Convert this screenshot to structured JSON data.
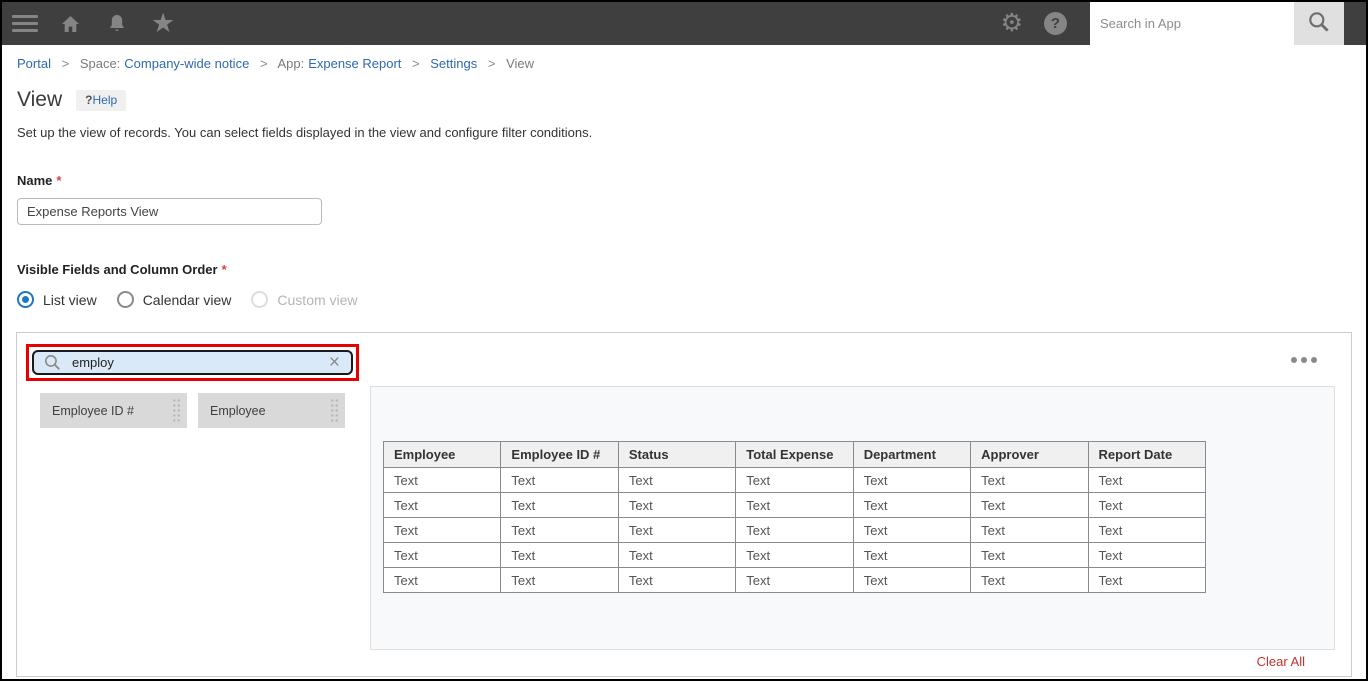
{
  "topbar": {
    "icons": [
      "hamburger-icon",
      "home-icon",
      "bell-icon",
      "star-icon",
      "gear-icon",
      "help-circle-icon",
      "magnifier-icon"
    ],
    "star_glyph": "★",
    "gear_glyph": "⚙",
    "help_glyph": "?",
    "search": {
      "placeholder": "Search in App",
      "value": ""
    }
  },
  "breadcrumb": {
    "separator": ">",
    "items": [
      {
        "prefix": "",
        "label": "Portal",
        "link": true
      },
      {
        "prefix": "Space:",
        "label": "Company-wide notice",
        "link": true
      },
      {
        "prefix": "App:",
        "label": "Expense Report",
        "link": true
      },
      {
        "prefix": "",
        "label": "Settings",
        "link": true
      },
      {
        "prefix": "",
        "label": "View",
        "link": false
      }
    ]
  },
  "header": {
    "title": "View",
    "help_q": "?",
    "help_text": "Help"
  },
  "description": "Set up the view of records. You can select fields displayed in the view and configure filter conditions.",
  "form": {
    "required_mark": "*",
    "name_label": "Name",
    "name_value": "Expense Reports View",
    "fields_section_label": "Visible Fields and Column Order",
    "view_options": [
      {
        "label": "List view",
        "selected": true,
        "disabled": false
      },
      {
        "label": "Calendar view",
        "selected": false,
        "disabled": false
      },
      {
        "label": "Custom view",
        "selected": false,
        "disabled": true
      }
    ]
  },
  "panel": {
    "field_search": {
      "value": "employ",
      "highlighted": true,
      "clear_glyph": "×"
    },
    "fields": [
      {
        "label": "Employee ID #"
      },
      {
        "label": "Employee"
      }
    ],
    "preview": {
      "columns": [
        "Employee",
        "Employee ID #",
        "Status",
        "Total Expense",
        "Department",
        "Approver",
        "Report Date"
      ],
      "rows": [
        [
          "Text",
          "Text",
          "Text",
          "Text",
          "Text",
          "Text",
          "Text"
        ],
        [
          "Text",
          "Text",
          "Text",
          "Text",
          "Text",
          "Text",
          "Text"
        ],
        [
          "Text",
          "Text",
          "Text",
          "Text",
          "Text",
          "Text",
          "Text"
        ],
        [
          "Text",
          "Text",
          "Text",
          "Text",
          "Text",
          "Text",
          "Text"
        ],
        [
          "Text",
          "Text",
          "Text",
          "Text",
          "Text",
          "Text",
          "Text"
        ]
      ]
    },
    "clear_all_label": "Clear All"
  },
  "colors": {
    "topbar_bg": "#3f3f3f",
    "topbar_icon": "#858585",
    "link_blue": "#3069b0",
    "required_red": "#e03e3e",
    "radio_blue": "#1f76c4",
    "annotation_red": "#e60000",
    "search_highlight": "#d9e9f8",
    "chip_bg": "#d9d9d9",
    "clear_red": "#c9302c"
  }
}
